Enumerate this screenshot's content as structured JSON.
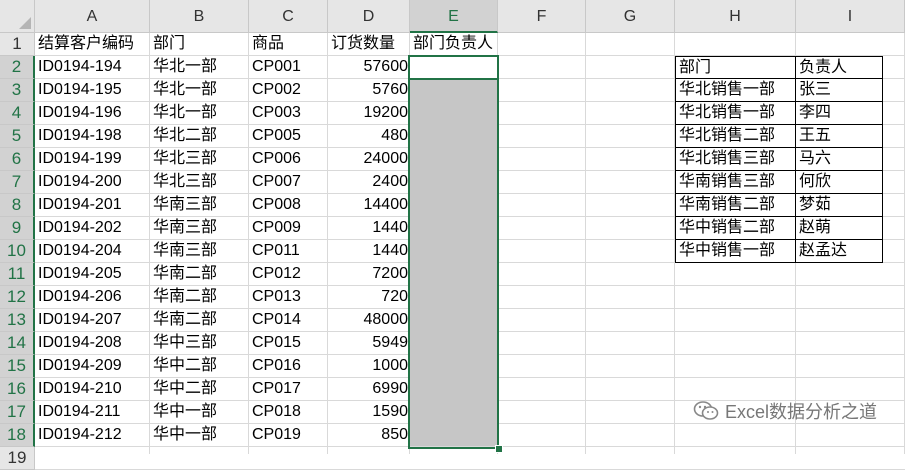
{
  "columns": [
    "A",
    "B",
    "C",
    "D",
    "E",
    "F",
    "G",
    "H",
    "I"
  ],
  "rows": [
    "1",
    "2",
    "3",
    "4",
    "5",
    "6",
    "7",
    "8",
    "9",
    "10",
    "11",
    "12",
    "13",
    "14",
    "15",
    "16",
    "17",
    "18",
    "19"
  ],
  "headers": {
    "a": "结算客户编码",
    "b": "部门",
    "c": "商品",
    "d": "订货数量",
    "e": "部门负责人"
  },
  "data": [
    {
      "code": "ID0194-194",
      "dept": "华北一部",
      "product": "CP001",
      "qty": "57600"
    },
    {
      "code": "ID0194-195",
      "dept": "华北一部",
      "product": "CP002",
      "qty": "5760"
    },
    {
      "code": "ID0194-196",
      "dept": "华北一部",
      "product": "CP003",
      "qty": "19200"
    },
    {
      "code": "ID0194-198",
      "dept": "华北二部",
      "product": "CP005",
      "qty": "480"
    },
    {
      "code": "ID0194-199",
      "dept": "华北三部",
      "product": "CP006",
      "qty": "24000"
    },
    {
      "code": "ID0194-200",
      "dept": "华北三部",
      "product": "CP007",
      "qty": "2400"
    },
    {
      "code": "ID0194-201",
      "dept": "华南三部",
      "product": "CP008",
      "qty": "14400"
    },
    {
      "code": "ID0194-202",
      "dept": "华南三部",
      "product": "CP009",
      "qty": "1440"
    },
    {
      "code": "ID0194-204",
      "dept": "华南三部",
      "product": "CP011",
      "qty": "1440"
    },
    {
      "code": "ID0194-205",
      "dept": "华南二部",
      "product": "CP012",
      "qty": "7200"
    },
    {
      "code": "ID0194-206",
      "dept": "华南二部",
      "product": "CP013",
      "qty": "720"
    },
    {
      "code": "ID0194-207",
      "dept": "华南二部",
      "product": "CP014",
      "qty": "48000"
    },
    {
      "code": "ID0194-208",
      "dept": "华中三部",
      "product": "CP015",
      "qty": "5949"
    },
    {
      "code": "ID0194-209",
      "dept": "华中二部",
      "product": "CP016",
      "qty": "1000"
    },
    {
      "code": "ID0194-210",
      "dept": "华中二部",
      "product": "CP017",
      "qty": "6990"
    },
    {
      "code": "ID0194-211",
      "dept": "华中一部",
      "product": "CP018",
      "qty": "1590"
    },
    {
      "code": "ID0194-212",
      "dept": "华中一部",
      "product": "CP019",
      "qty": "850"
    }
  ],
  "lookup": {
    "headers": [
      "部门",
      "负责人"
    ],
    "rows": [
      [
        "华北销售一部",
        "张三"
      ],
      [
        "华北销售一部",
        "李四"
      ],
      [
        "华北销售二部",
        "王五"
      ],
      [
        "华北销售三部",
        "马六"
      ],
      [
        "华南销售三部",
        "何欣"
      ],
      [
        "华南销售二部",
        "梦茹"
      ],
      [
        "华中销售二部",
        "赵萌"
      ],
      [
        "华中销售一部",
        "赵孟达"
      ]
    ]
  },
  "selection": {
    "column": "E"
  },
  "watermark": {
    "text": "Excel数据分析之道",
    "icon": "wechat-icon"
  },
  "colors": {
    "accent": "#217346",
    "selection_fill": "#c6c6c6"
  }
}
